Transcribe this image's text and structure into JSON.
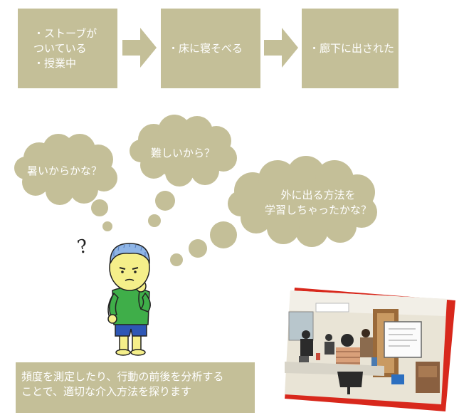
{
  "flow": {
    "box1": [
      "・ストーブが",
      "ついている",
      "・授業中"
    ],
    "box2": [
      "・床に寝そべる"
    ],
    "box3": [
      "・廊下に出された"
    ]
  },
  "thoughts": {
    "cloud1": [
      "暑いからかな？"
    ],
    "cloud2": [
      "難しいから？"
    ],
    "cloud3": [
      "外に出る方法を",
      "学習しちゃったかな？"
    ]
  },
  "question_mark": "?",
  "caption": [
    "頻度を測定したり、行動の前後を分析する",
    "ことで、適切な介入方法を探ります"
  ],
  "colors": {
    "box": "#c4bf98",
    "text": "#ffffff",
    "accent_red": "#d8281c"
  },
  "icons": [
    "arrow-right-icon",
    "thought-cloud",
    "thinking-boy-illustration",
    "classroom-photo"
  ]
}
